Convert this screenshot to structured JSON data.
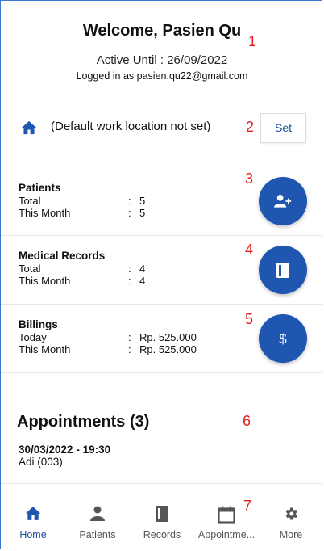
{
  "header": {
    "welcome": "Welcome, Pasien Qu",
    "active_until": "Active Until : 26/09/2022",
    "logged_in": "Logged in as pasien.qu22@gmail.com"
  },
  "location": {
    "text": "(Default work location not set)",
    "set_label": "Set"
  },
  "stats": {
    "patients": {
      "title": "Patients",
      "rows": [
        {
          "label": "Total",
          "sep": ":",
          "value": "5"
        },
        {
          "label": "This Month",
          "sep": ":",
          "value": "5"
        }
      ]
    },
    "records": {
      "title": "Medical Records",
      "rows": [
        {
          "label": "Total",
          "sep": ":",
          "value": "4"
        },
        {
          "label": "This Month",
          "sep": ":",
          "value": "4"
        }
      ]
    },
    "billings": {
      "title": "Billings",
      "rows": [
        {
          "label": "Today",
          "sep": ":",
          "value": "Rp. 525.000"
        },
        {
          "label": "This Month",
          "sep": ":",
          "value": "Rp. 525.000"
        }
      ]
    }
  },
  "fabs": {
    "add_patient_icon": "add-person-icon",
    "record_icon": "book-icon",
    "billing_icon": "dollar-icon",
    "color": "#1f56b0"
  },
  "appointments": {
    "title": "Appointments (3)",
    "items": [
      {
        "datetime": "30/03/2022 - 19:30",
        "patient": "Adi (003)"
      }
    ]
  },
  "annotations": [
    "1",
    "2",
    "3",
    "4",
    "5",
    "6",
    "7"
  ],
  "tabs": [
    {
      "label": "Home",
      "icon": "home-icon",
      "active": true
    },
    {
      "label": "Patients",
      "icon": "person-icon",
      "active": false
    },
    {
      "label": "Records",
      "icon": "book-icon",
      "active": false
    },
    {
      "label": "Appointme...",
      "icon": "calendar-icon",
      "active": false
    },
    {
      "label": "More",
      "icon": "gear-icon",
      "active": false
    }
  ],
  "colors": {
    "primary": "#1f56b0",
    "annotation": "#e0201f",
    "frame": "#3a78d6"
  }
}
